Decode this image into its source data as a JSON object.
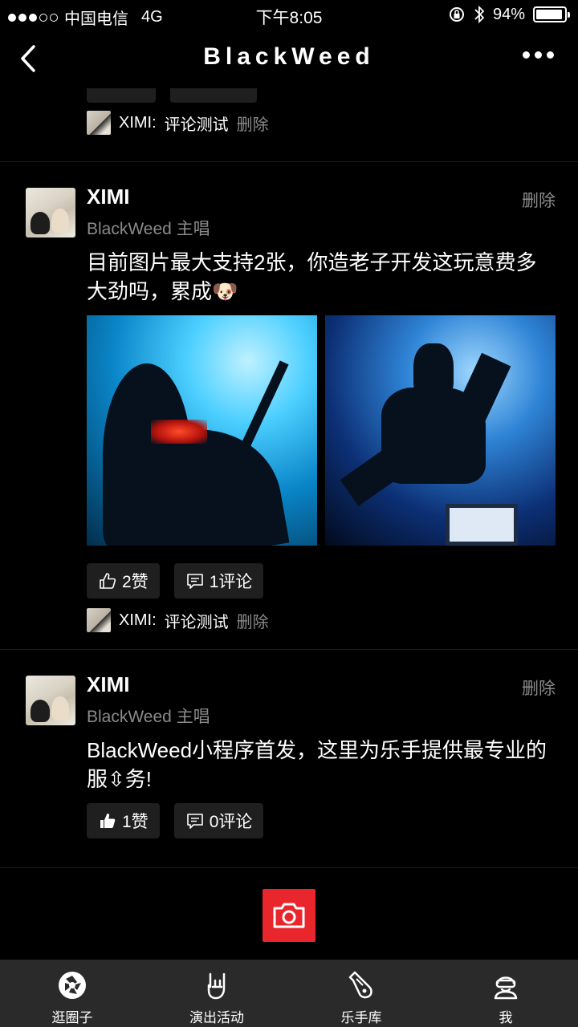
{
  "status_bar": {
    "carrier": "中国电信",
    "network": "4G",
    "time": "下午8:05",
    "battery_percent": "94%",
    "battery_level": 0.94
  },
  "nav": {
    "title": "BlackWeed"
  },
  "partial_post": {
    "comment": {
      "author": "XIMI:",
      "text": "评论测试",
      "delete_label": "删除"
    }
  },
  "posts": [
    {
      "name": "XIMI",
      "delete_label": "删除",
      "role": "BlackWeed 主唱",
      "text": "目前图片最大支持2张，你造老子开发这玩意费多大劲吗，累成🐶",
      "likes_label": "2赞",
      "comments_label": "1评论",
      "comment": {
        "author": "XIMI:",
        "text": "评论测试",
        "delete_label": "删除"
      }
    },
    {
      "name": "XIMI",
      "delete_label": "删除",
      "role": "BlackWeed 主唱",
      "text": "BlackWeed小程序首发，这里为乐手提供最专业的服⇳务!",
      "likes_label": "1赞",
      "comments_label": "0评论"
    }
  ],
  "tabs": [
    {
      "label": "逛圈子",
      "icon": "aperture-icon"
    },
    {
      "label": "演出活动",
      "icon": "rock-hand-icon"
    },
    {
      "label": "乐手库",
      "icon": "guitar-icon"
    },
    {
      "label": "我",
      "icon": "user-icon"
    }
  ],
  "colors": {
    "accent": "#e8262c",
    "background": "#000000",
    "muted_text": "#8a8a8a",
    "button_bg": "#1f1f1f",
    "tabbar_bg": "#2a2a2a"
  }
}
